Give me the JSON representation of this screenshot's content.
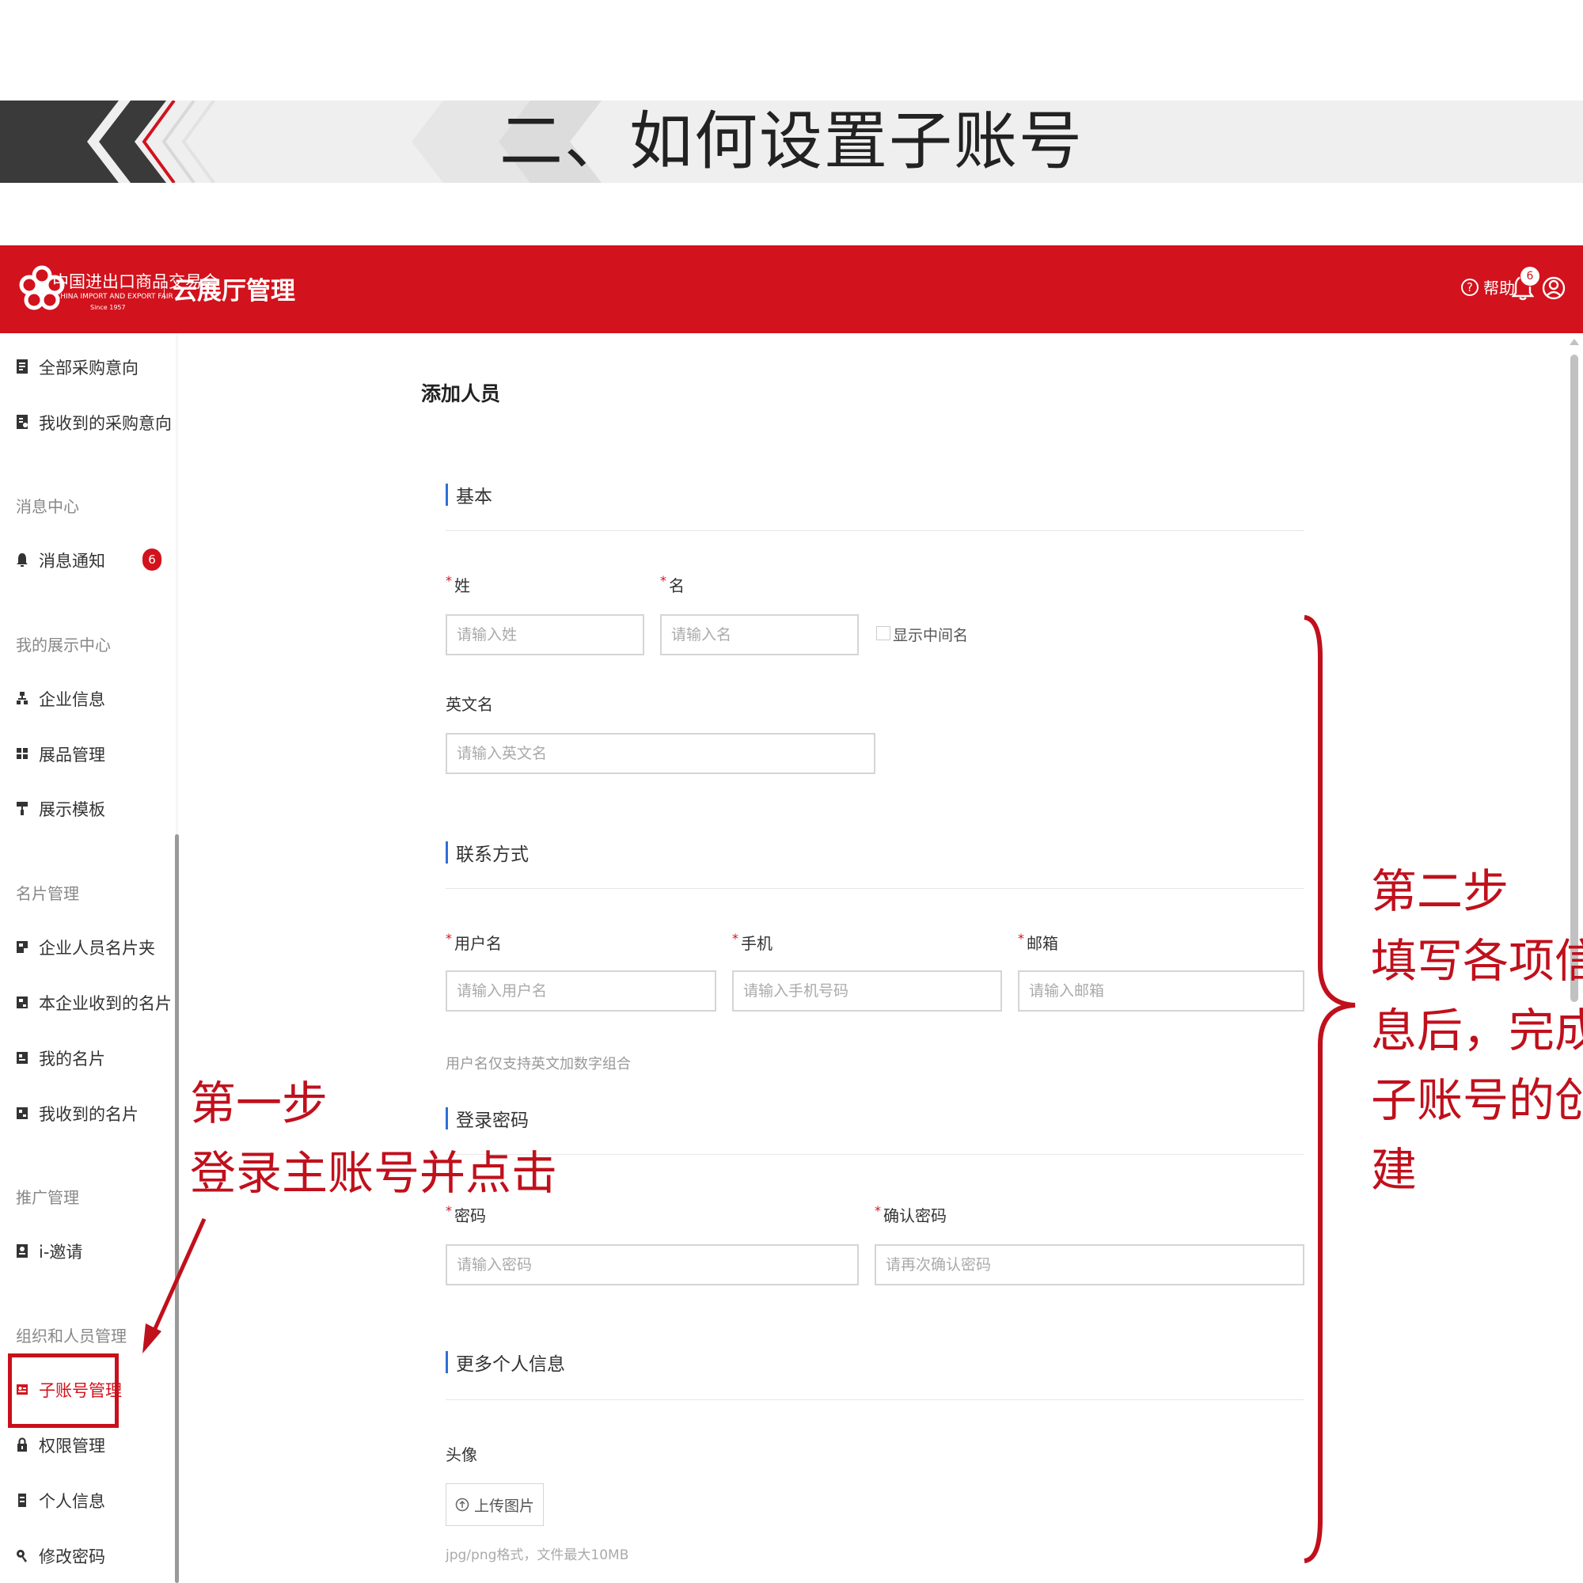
{
  "slide": {
    "title": "二、如何设置子账号"
  },
  "header": {
    "logo_cn": "中国进出口商品交易会",
    "logo_en": "CHINA IMPORT AND EXPORT FAIR",
    "logo_since": "Since 1957",
    "app_name": "云展厅管理",
    "help_label": "帮助",
    "help_glyph": "?",
    "notification_count": "6",
    "brand_color": "#d2121c"
  },
  "sidebar": {
    "items": [
      {
        "label": "全部采购意向",
        "icon": "document-icon"
      },
      {
        "label": "我收到的采购意向",
        "icon": "document-received-icon"
      },
      {
        "label": "消息通知",
        "icon": "bell-icon",
        "badge": "6"
      },
      {
        "label": "企业信息",
        "icon": "organization-icon"
      },
      {
        "label": "展品管理",
        "icon": "grid-icon"
      },
      {
        "label": "展示模板",
        "icon": "paint-roller-icon"
      },
      {
        "label": "企业人员名片夹",
        "icon": "card-holder-icon"
      },
      {
        "label": "本企业收到的名片",
        "icon": "card-received-icon"
      },
      {
        "label": "我的名片",
        "icon": "card-icon"
      },
      {
        "label": "我收到的名片",
        "icon": "card-inbox-icon"
      },
      {
        "label": "i-邀请",
        "icon": "invite-icon"
      },
      {
        "label": "子账号管理",
        "icon": "sub-account-icon",
        "active": true
      },
      {
        "label": "权限管理",
        "icon": "lock-icon"
      },
      {
        "label": "个人信息",
        "icon": "id-icon"
      },
      {
        "label": "修改密码",
        "icon": "key-icon"
      }
    ],
    "sections": {
      "messages": "消息中心",
      "display": "我的展示中心",
      "cards": "名片管理",
      "promotion": "推广管理",
      "org": "组织和人员管理"
    }
  },
  "form": {
    "title": "添加人员",
    "sections": {
      "basic": "基本",
      "contact": "联系方式",
      "password": "登录密码",
      "more": "更多个人信息"
    },
    "required_mark": "*",
    "fields": {
      "last_name": {
        "label": "姓",
        "placeholder": "请输入姓"
      },
      "first_name": {
        "label": "名",
        "placeholder": "请输入名"
      },
      "show_middle_name": "显示中间名",
      "english_name": {
        "label": "英文名",
        "placeholder": "请输入英文名"
      },
      "username": {
        "label": "用户名",
        "placeholder": "请输入用户名",
        "hint": "用户名仅支持英文加数字组合"
      },
      "phone": {
        "label": "手机",
        "placeholder": "请输入手机号码"
      },
      "email": {
        "label": "邮箱",
        "placeholder": "请输入邮箱"
      },
      "password": {
        "label": "密码",
        "placeholder": "请输入密码"
      },
      "confirm_password": {
        "label": "确认密码",
        "placeholder": "请再次确认密码"
      },
      "avatar": {
        "label": "头像",
        "button": "上传图片",
        "hint": "jpg/png格式，文件最大10MB"
      }
    }
  },
  "annotations": {
    "step1_title": "第一步",
    "step1_text": "登录主账号并点击",
    "step2_title": "第二步",
    "step2_lines": [
      "填写各项信",
      "息后，完成",
      "子账号的创",
      "建"
    ],
    "color": "#c0101c"
  }
}
